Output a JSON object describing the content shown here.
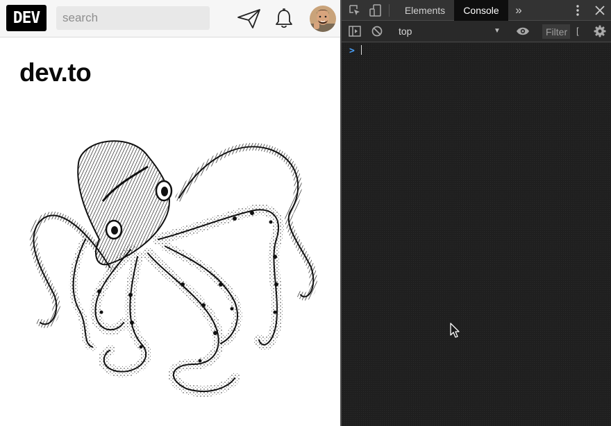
{
  "site": {
    "logo_text": "DEV",
    "search_placeholder": "search",
    "title": "dev.to",
    "icons": {
      "send": "paper-plane-icon",
      "notifications": "bell-icon",
      "avatar": "user-avatar"
    }
  },
  "devtools": {
    "tabs": [
      {
        "label": "Elements",
        "active": false
      },
      {
        "label": "Console",
        "active": true
      }
    ],
    "more_tabs": "»",
    "console_context": "top",
    "filter_placeholder": "Filter",
    "levels_truncated": "[",
    "prompt_symbol": ">",
    "colors": {
      "panel_bg": "#242424",
      "tab_active_bg": "#0e0e0e",
      "prompt": "#4aa3ff"
    }
  }
}
